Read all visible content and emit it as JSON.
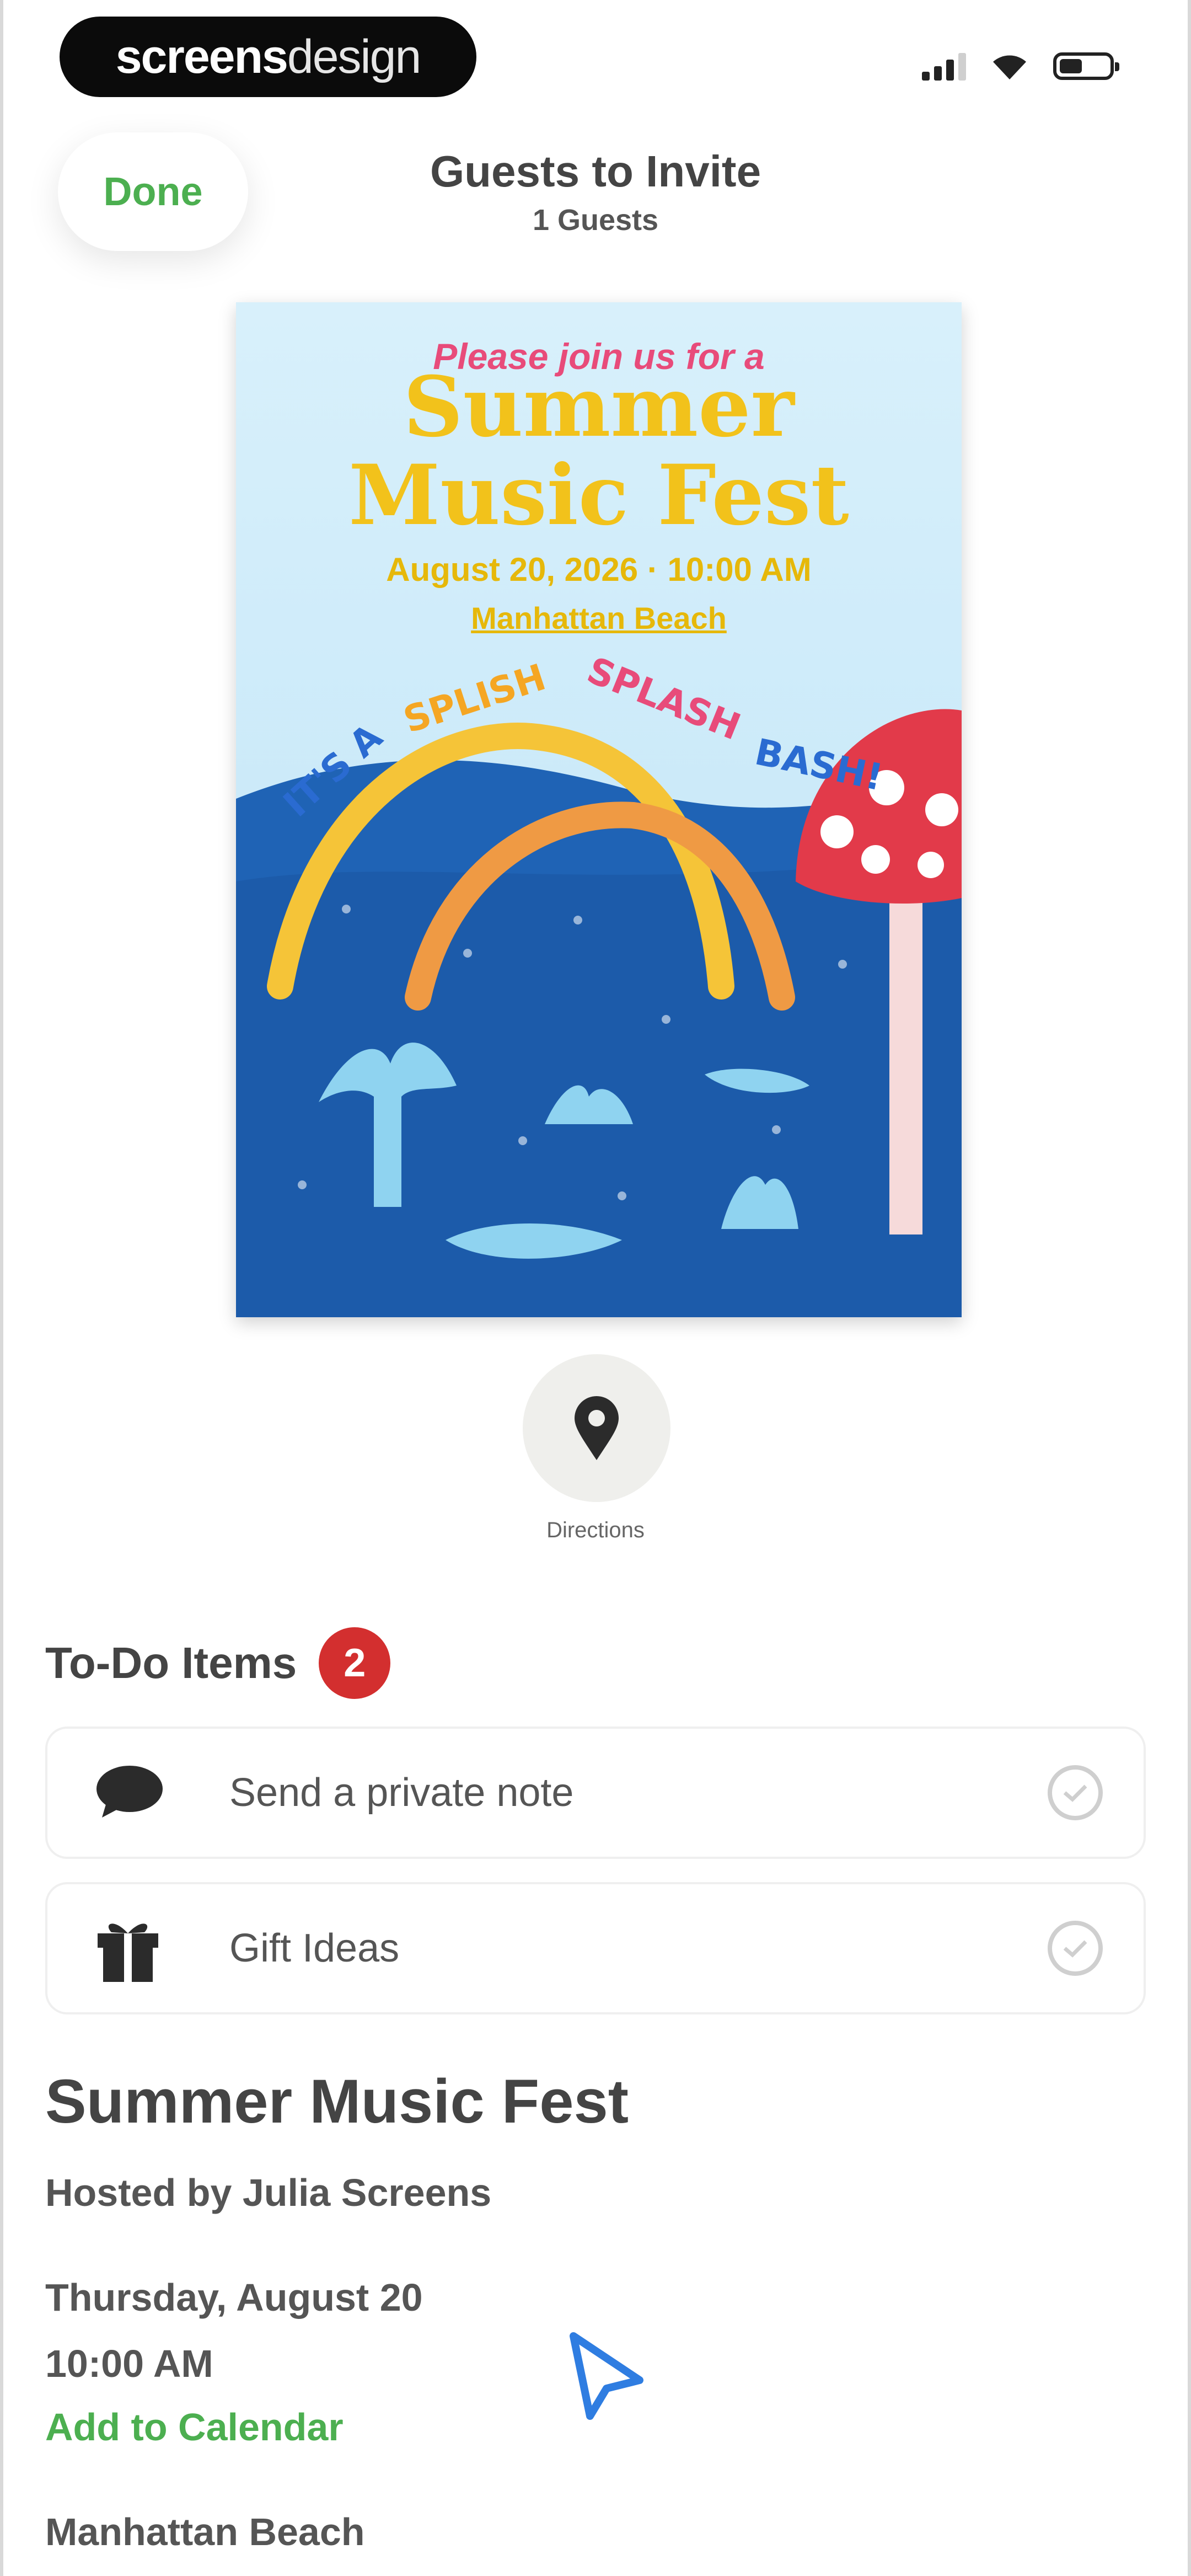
{
  "status_bar": {
    "brand_bold": "screens",
    "brand_light": "design"
  },
  "header": {
    "done_label": "Done",
    "title": "Guests to Invite",
    "subtitle": "1 Guests"
  },
  "invitation": {
    "pre_title": "Please join us for a",
    "title_line1": "Summer",
    "title_line2": "Music Fest",
    "date_line": "August 20, 2026 · 10:00 AM",
    "venue_line": "Manhattan Beach",
    "splash_words": [
      "IT'S A",
      "SPLISH",
      "SPLASH",
      "BASH!"
    ],
    "colors": {
      "title": "#f2c21b",
      "pre": "#e84b7a",
      "water": "#1f63b5"
    }
  },
  "directions": {
    "label": "Directions",
    "icon": "map-pin-icon"
  },
  "todo": {
    "heading": "To-Do Items",
    "badge_count": "2",
    "items": [
      {
        "label": "Send a private note",
        "icon": "speech-bubble-icon"
      },
      {
        "label": "Gift Ideas",
        "icon": "gift-icon"
      }
    ]
  },
  "event": {
    "title": "Summer Music Fest",
    "host": "Hosted by Julia Screens",
    "day": "Thursday, August 20",
    "time": "10:00 AM",
    "add_calendar": "Add to Calendar",
    "location": "Manhattan Beach"
  },
  "colors": {
    "accent": "#4caf50",
    "badge": "#d32f2f"
  }
}
